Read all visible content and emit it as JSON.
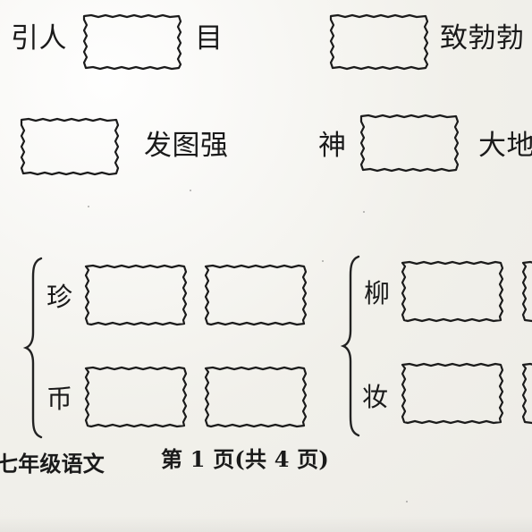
{
  "top_row": {
    "left_prefix": "引人",
    "left_suffix": "目",
    "right_suffix": "致勃勃"
  },
  "middle_row": {
    "left_suffix": "发图强",
    "right_prefix": "神",
    "right_suffix": "大地"
  },
  "grid_left": {
    "top_char": "珍",
    "bottom_char": "币"
  },
  "grid_right": {
    "top_char": "柳",
    "bottom_char": "妆"
  },
  "footer": {
    "left_text": "七年级语文",
    "center_text": "第 1 页(共 4 页)"
  }
}
